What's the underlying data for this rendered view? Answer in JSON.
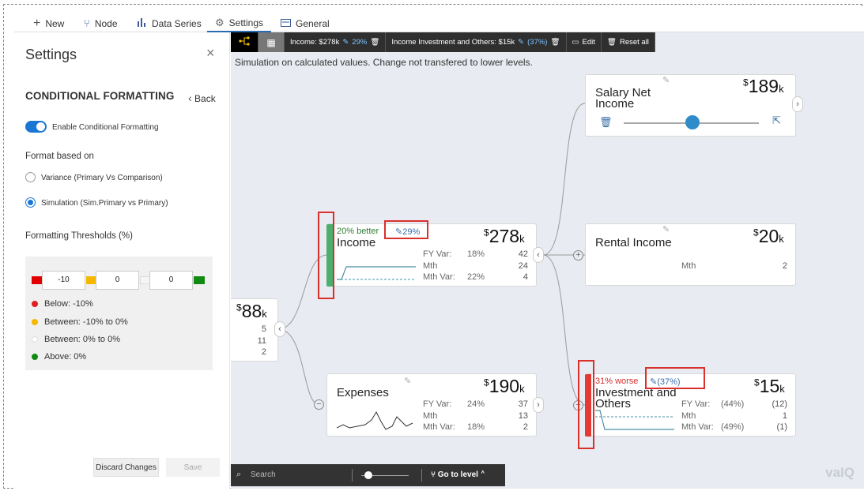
{
  "tabs": [
    {
      "label": "New",
      "icon": "plus-icon"
    },
    {
      "label": "Node",
      "icon": "node-icon"
    },
    {
      "label": "Data Series",
      "icon": "bar-chart-icon"
    },
    {
      "label": "Settings",
      "icon": "gear-icon"
    },
    {
      "label": "General",
      "icon": "card-icon"
    }
  ],
  "settings": {
    "title": "Settings",
    "section": "CONDITIONAL FORMATTING",
    "back": "Back",
    "enable_label": "Enable Conditional Formatting",
    "format_based_on": "Format based on",
    "radio_variance": "Variance (Primary Vs Comparison)",
    "radio_simulation": "Simulation (Sim.Primary vs Primary)",
    "thresholds_label": "Formatting Thresholds (%)",
    "thresholds": [
      "-10",
      "0",
      "0"
    ],
    "legend": [
      {
        "label": "Below: -10%",
        "color": "#e02020"
      },
      {
        "label": "Between: -10% to 0%",
        "color": "#f5b800"
      },
      {
        "label": "Between: 0% to 0%",
        "color": "#ffffff"
      },
      {
        "label": "Above: 0%",
        "color": "#108a10"
      }
    ],
    "discard": "Discard Changes",
    "save": "Save"
  },
  "toolbar": {
    "income": "Income: $278k",
    "income_pct": "29%",
    "investment": "Income Investment and Others: $15k",
    "investment_pct": "(37%)",
    "edit": "Edit",
    "reset": "Reset all"
  },
  "sim_note": "Simulation on calculated values. Change not transfered to lower levels.",
  "root": {
    "value": "88",
    "rows": [
      "5",
      "11",
      "2"
    ]
  },
  "income": {
    "badge": "20% better",
    "sim_pct": "29%",
    "title": "Income",
    "value": "278",
    "rows": [
      {
        "label": "FY Var:",
        "pct": "18%",
        "num": "42"
      },
      {
        "label": "Mth",
        "pct": "",
        "num": "24"
      },
      {
        "label": "Mth Var:",
        "pct": "22%",
        "num": "4"
      }
    ]
  },
  "expenses": {
    "title": "Expenses",
    "value": "190",
    "rows": [
      {
        "label": "FY Var:",
        "pct": "24%",
        "num": "37"
      },
      {
        "label": "Mth",
        "pct": "",
        "num": "13"
      },
      {
        "label": "Mth Var:",
        "pct": "18%",
        "num": "2"
      }
    ]
  },
  "salary": {
    "title_1": "Salary Net",
    "title_2": "Income",
    "value": "189",
    "slider_level": 0.51
  },
  "rental": {
    "title": "Rental Income",
    "value": "20",
    "row_label": "Mth",
    "row_num": "2"
  },
  "investment": {
    "badge": "31% worse",
    "sim_pct": "(37%)",
    "title_1": "Investment and",
    "title_2": "Others",
    "value": "15",
    "rows": [
      {
        "label": "FY Var:",
        "pct": "(44%)",
        "num": "(12)"
      },
      {
        "label": "Mth",
        "pct": "",
        "num": "1"
      },
      {
        "label": "Mth Var:",
        "pct": "(49%)",
        "num": "(1)"
      }
    ]
  },
  "bottom": {
    "search_placeholder": "Search",
    "goto": "Go to level",
    "zoom_level": 0.15
  },
  "watermark": "valQ",
  "colors": {
    "accent": "#1976d2",
    "better": "#2e7d32",
    "worse": "#d32f2f",
    "bar_green": "#4caf6e",
    "bar_red": "#e53935"
  }
}
